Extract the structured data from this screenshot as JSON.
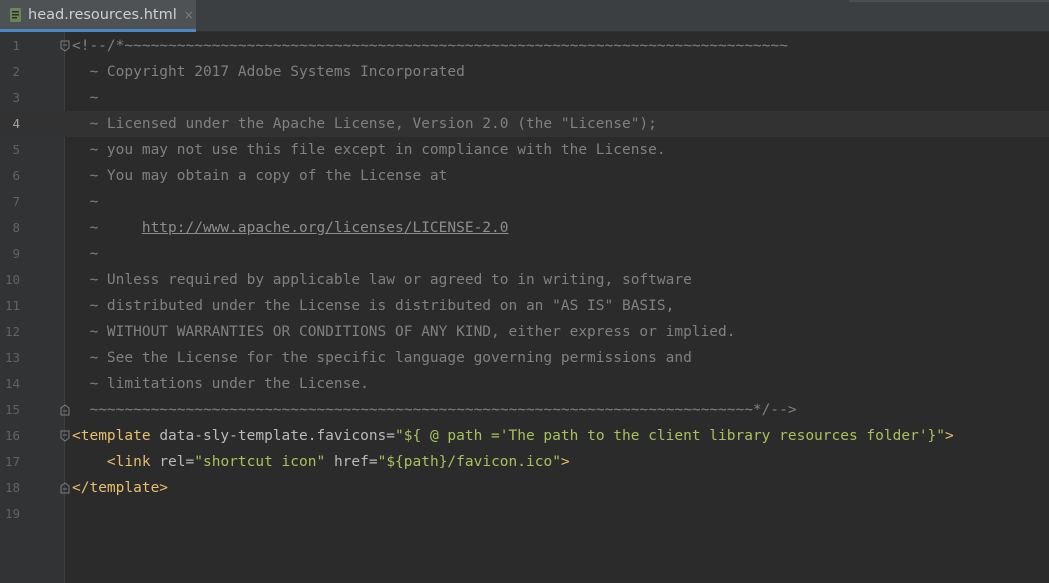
{
  "tab": {
    "filename": "head.resources.html",
    "close_glyph": "×",
    "icon": "html-file-icon"
  },
  "colors": {
    "background": "#2b2b2b",
    "gutter": "#313335",
    "comment": "#808080",
    "tag": "#e8bf6a",
    "attribute": "#bababa",
    "string": "#a5c25c",
    "tab_active_underline": "#4a88c7"
  },
  "editor": {
    "current_line": 4,
    "lines": [
      {
        "num": "1",
        "segments": [
          {
            "t": "<!--/*~~~~~~~~~~~~~~~~~~~~~~~~~~~~~~~~~~~~~~~~~~~~~~~~~~~~~~~~~~~~~~~~~~~~~~~~~~~~",
            "c": "comment"
          }
        ],
        "fold": "open"
      },
      {
        "num": "2",
        "segments": [
          {
            "t": "  ~ Copyright 2017 Adobe Systems Incorporated",
            "c": "comment"
          }
        ]
      },
      {
        "num": "3",
        "segments": [
          {
            "t": "  ~",
            "c": "comment"
          }
        ]
      },
      {
        "num": "4",
        "segments": [
          {
            "t": "  ~ Licensed under the Apache License, Version 2.0 (the \"License\");",
            "c": "comment"
          }
        ]
      },
      {
        "num": "5",
        "segments": [
          {
            "t": "  ~ you may not use this file except in compliance with the License.",
            "c": "comment"
          }
        ]
      },
      {
        "num": "6",
        "segments": [
          {
            "t": "  ~ You may obtain a copy of the License at",
            "c": "comment"
          }
        ]
      },
      {
        "num": "7",
        "segments": [
          {
            "t": "  ~",
            "c": "comment"
          }
        ]
      },
      {
        "num": "8",
        "segments": [
          {
            "t": "  ~     ",
            "c": "comment"
          },
          {
            "t": "http://www.apache.org/licenses/LICENSE-2.0",
            "c": "link"
          }
        ]
      },
      {
        "num": "9",
        "segments": [
          {
            "t": "  ~",
            "c": "comment"
          }
        ]
      },
      {
        "num": "10",
        "segments": [
          {
            "t": "  ~ Unless required by applicable law or agreed to in writing, software",
            "c": "comment"
          }
        ]
      },
      {
        "num": "11",
        "segments": [
          {
            "t": "  ~ distributed under the License is distributed on an \"AS IS\" BASIS,",
            "c": "comment"
          }
        ]
      },
      {
        "num": "12",
        "segments": [
          {
            "t": "  ~ WITHOUT WARRANTIES OR CONDITIONS OF ANY KIND, either express or implied.",
            "c": "comment"
          }
        ]
      },
      {
        "num": "13",
        "segments": [
          {
            "t": "  ~ See the License for the specific language governing permissions and",
            "c": "comment"
          }
        ]
      },
      {
        "num": "14",
        "segments": [
          {
            "t": "  ~ limitations under the License.",
            "c": "comment"
          }
        ]
      },
      {
        "num": "15",
        "segments": [
          {
            "t": "  ~~~~~~~~~~~~~~~~~~~~~~~~~~~~~~~~~~~~~~~~~~~~~~~~~~~~~~~~~~~~~~~~~~~~~~~~~~~~*/-->",
            "c": "comment"
          }
        ],
        "fold": "close"
      },
      {
        "num": "16",
        "segments": [
          {
            "t": "<template ",
            "c": "tag"
          },
          {
            "t": "data-sly-template.favicons",
            "c": "attr"
          },
          {
            "t": "=",
            "c": "attr"
          },
          {
            "t": "\"${ @ path ='The path to the client library resources folder'}\"",
            "c": "str"
          },
          {
            "t": ">",
            "c": "tag"
          }
        ],
        "fold": "open"
      },
      {
        "num": "17",
        "segments": [
          {
            "t": "    <link ",
            "c": "tag"
          },
          {
            "t": "rel",
            "c": "attr"
          },
          {
            "t": "=",
            "c": "attr"
          },
          {
            "t": "\"shortcut icon\" ",
            "c": "str"
          },
          {
            "t": "href",
            "c": "attr"
          },
          {
            "t": "=",
            "c": "attr"
          },
          {
            "t": "\"${path}/favicon.ico\"",
            "c": "str"
          },
          {
            "t": ">",
            "c": "tag"
          }
        ]
      },
      {
        "num": "18",
        "segments": [
          {
            "t": "</template>",
            "c": "tag"
          }
        ],
        "fold": "close"
      },
      {
        "num": "19",
        "segments": []
      }
    ]
  }
}
